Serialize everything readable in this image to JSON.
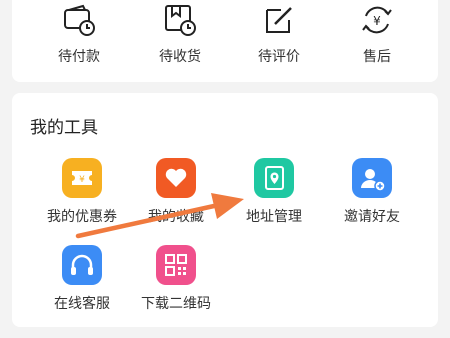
{
  "orders": {
    "items": [
      {
        "label": "待付款",
        "icon": "wallet-clock-icon"
      },
      {
        "label": "待收货",
        "icon": "package-clock-icon"
      },
      {
        "label": "待评价",
        "icon": "edit-review-icon"
      },
      {
        "label": "售后",
        "icon": "yen-refund-icon"
      }
    ]
  },
  "tools": {
    "title": "我的工具",
    "items": [
      {
        "label": "我的优惠券",
        "icon": "coupon-icon",
        "color": "#F7B021"
      },
      {
        "label": "我的收藏",
        "icon": "heart-icon",
        "color": "#F15A24"
      },
      {
        "label": "地址管理",
        "icon": "address-book-icon",
        "color": "#1FC8A2"
      },
      {
        "label": "邀请好友",
        "icon": "invite-user-icon",
        "color": "#3C8CF5"
      },
      {
        "label": "在线客服",
        "icon": "headset-icon",
        "color": "#3C8CF5"
      },
      {
        "label": "下载二维码",
        "icon": "qr-code-icon",
        "color": "#F0508C"
      }
    ]
  },
  "annotation": {
    "arrow_color": "#F07A3E"
  }
}
